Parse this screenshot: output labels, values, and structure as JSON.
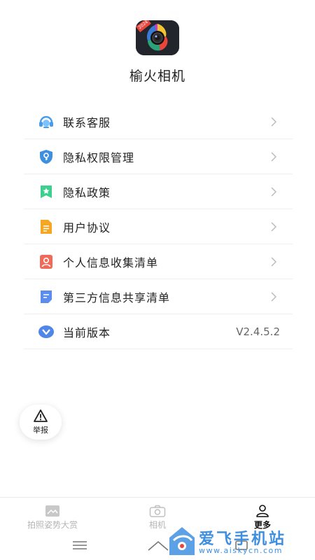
{
  "app": {
    "name": "榆火相机",
    "logo_badge": "2024"
  },
  "menu": {
    "items": [
      {
        "label": "联系客服",
        "icon": "headset-icon"
      },
      {
        "label": "隐私权限管理",
        "icon": "shield-key-icon"
      },
      {
        "label": "隐私政策",
        "icon": "bookmark-star-icon"
      },
      {
        "label": "用户协议",
        "icon": "document-icon"
      },
      {
        "label": "个人信息收集清单",
        "icon": "user-card-icon"
      },
      {
        "label": "第三方信息共享清单",
        "icon": "note-icon"
      },
      {
        "label": "当前版本",
        "icon": "version-icon",
        "value": "V2.4.5.2"
      }
    ]
  },
  "report": {
    "label": "举报",
    "icon": "warning-icon"
  },
  "tabs": [
    {
      "label": "拍照姿势大赏",
      "icon": "image-icon",
      "active": false
    },
    {
      "label": "相机",
      "icon": "camera-icon",
      "active": false
    },
    {
      "label": "更多",
      "icon": "person-icon",
      "active": true
    }
  ],
  "watermark": {
    "text": "爱飞手机站",
    "url": "www.aiskycn.com"
  },
  "colors": {
    "accent": "#3f8fe0",
    "text": "#222222",
    "inactive_tab": "#b5b5b5"
  }
}
